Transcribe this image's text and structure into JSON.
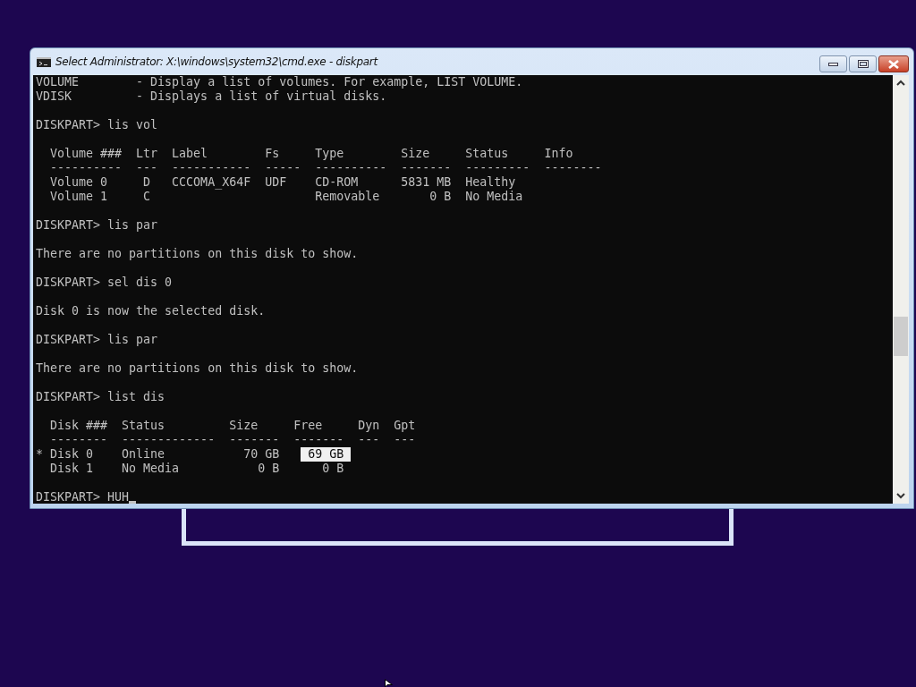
{
  "window": {
    "title": "Select Administrator: X:\\windows\\system32\\cmd.exe - diskpart"
  },
  "console": {
    "lines": [
      {
        "kind": "text",
        "text": "VOLUME        - Display a list of volumes. For example, LIST VOLUME.",
        "cursor": false
      },
      {
        "kind": "text",
        "text": "VDISK         - Displays a list of virtual disks.",
        "cursor": false
      },
      {
        "kind": "blank"
      },
      {
        "kind": "text",
        "text": "DISKPART> lis vol",
        "cursor": false
      },
      {
        "kind": "blank"
      },
      {
        "kind": "text",
        "text": "  Volume ###  Ltr  Label        Fs     Type        Size     Status     Info",
        "cursor": false
      },
      {
        "kind": "text",
        "text": "  ----------  ---  -----------  -----  ----------  -------  ---------  --------",
        "cursor": false
      },
      {
        "kind": "text",
        "text": "  Volume 0     D   CCCOMA_X64F  UDF    CD-ROM      5831 MB  Healthy",
        "cursor": false
      },
      {
        "kind": "text",
        "text": "  Volume 1     C                       Removable       0 B  No Media",
        "cursor": false
      },
      {
        "kind": "blank"
      },
      {
        "kind": "text",
        "text": "DISKPART> lis par",
        "cursor": false
      },
      {
        "kind": "blank"
      },
      {
        "kind": "text",
        "text": "There are no partitions on this disk to show.",
        "cursor": false
      },
      {
        "kind": "blank"
      },
      {
        "kind": "text",
        "text": "DISKPART> sel dis 0",
        "cursor": false
      },
      {
        "kind": "blank"
      },
      {
        "kind": "text",
        "text": "Disk 0 is now the selected disk.",
        "cursor": false
      },
      {
        "kind": "blank"
      },
      {
        "kind": "text",
        "text": "DISKPART> lis par",
        "cursor": false
      },
      {
        "kind": "blank"
      },
      {
        "kind": "text",
        "text": "There are no partitions on this disk to show.",
        "cursor": false
      },
      {
        "kind": "blank"
      },
      {
        "kind": "text",
        "text": "DISKPART> list dis",
        "cursor": false
      },
      {
        "kind": "blank"
      },
      {
        "kind": "text",
        "text": "  Disk ###  Status         Size     Free     Dyn  Gpt",
        "cursor": false
      },
      {
        "kind": "text",
        "text": "  --------  -------------  -------  -------  ---  ---",
        "cursor": false
      },
      {
        "kind": "segments",
        "segments": [
          {
            "text": "* Disk 0    Online           70 GB   ",
            "selected": false
          },
          {
            "text": " 69 GB ",
            "selected": true
          }
        ]
      },
      {
        "kind": "text",
        "text": "  Disk 1    No Media           0 B      0 B",
        "cursor": false
      },
      {
        "kind": "blank"
      },
      {
        "kind": "text",
        "text": "DISKPART> HUH",
        "cursor": true
      }
    ]
  }
}
